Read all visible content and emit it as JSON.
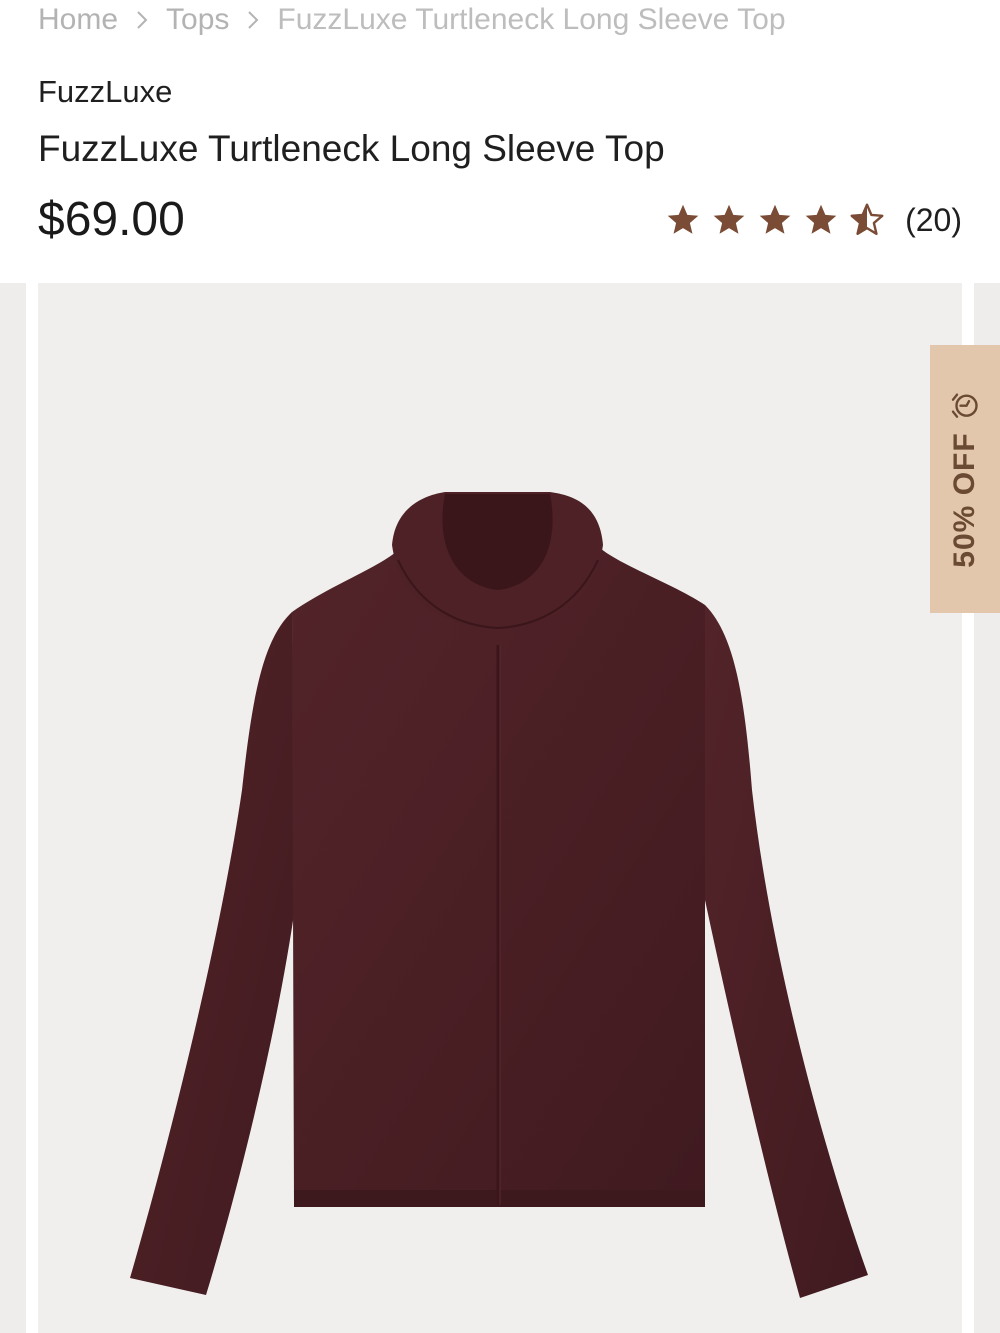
{
  "breadcrumb": {
    "items": [
      {
        "label": "Home"
      },
      {
        "label": "Tops"
      }
    ],
    "current": "FuzzLuxe Turtleneck Long Sleeve Top"
  },
  "product": {
    "brand": "FuzzLuxe",
    "title": "FuzzLuxe Turtleneck Long Sleeve Top",
    "price": "$69.00",
    "rating": {
      "value": 4.5,
      "max": 5,
      "count_label": "(20)"
    },
    "discount_badge": {
      "label": "50% OFF",
      "icon": "alarm-clock-icon"
    },
    "image": {
      "icon": "turtleneck-sweater-image",
      "garment_color": "#4a1f24"
    }
  },
  "colors": {
    "star": "#7a4b35",
    "badge_bg": "#e2c7ad",
    "badge_text": "#6b4a33",
    "image_bg": "#f1efed"
  }
}
